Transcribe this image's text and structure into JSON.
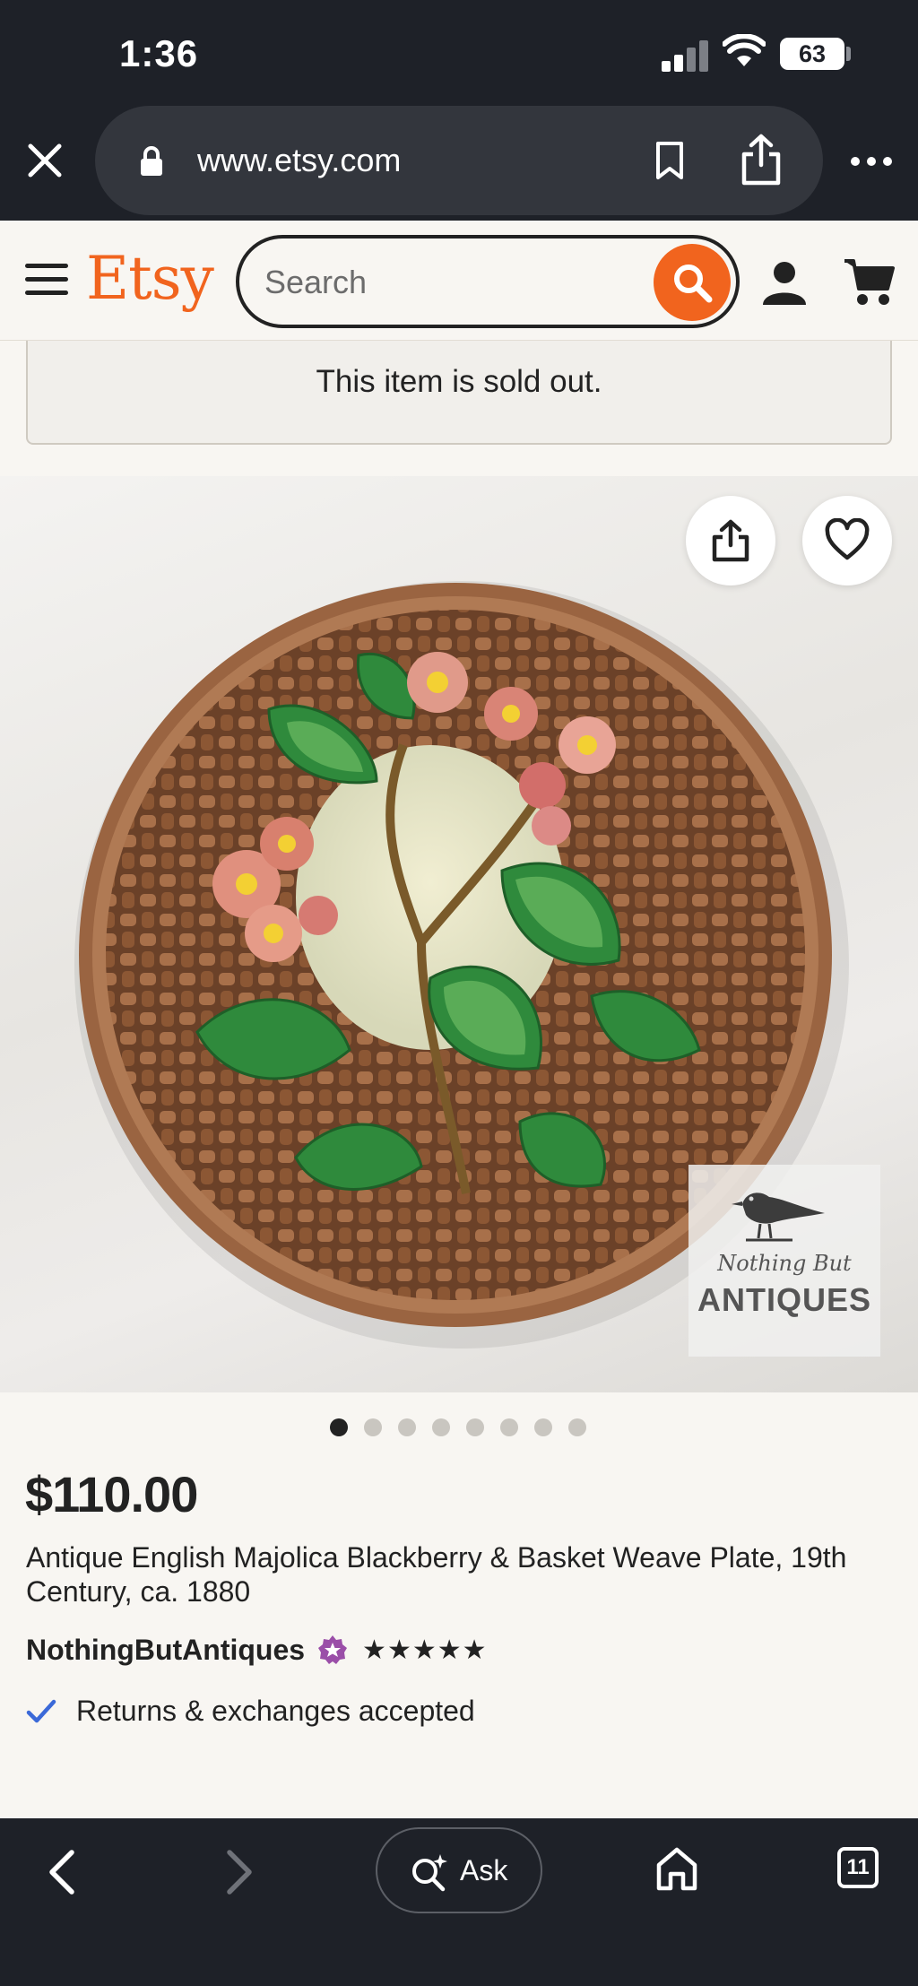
{
  "status_bar": {
    "time": "1:36",
    "battery": "63"
  },
  "browser": {
    "url": "www.etsy.com",
    "ask_label": "Ask",
    "tab_count": "11"
  },
  "header": {
    "logo": "Etsy",
    "search_placeholder": "Search",
    "brand_color": "#f1641e"
  },
  "listing": {
    "sold_out_message": "This item is sold out.",
    "price": "$110.00",
    "title": "Antique English Majolica Blackberry & Basket Weave Plate, 19th Century, ca. 1880",
    "shop_name": "NothingButAntiques",
    "rating_stars": "★★★★★",
    "returns_text": "Returns & exchanges accepted",
    "image_count": 8,
    "active_image_index": 0,
    "watermark": {
      "script": "Nothing But",
      "main": "ANTIQUES"
    }
  },
  "icons": {
    "close": "close-icon",
    "lock": "lock-icon",
    "bookmark": "bookmark-icon",
    "share": "share-icon",
    "more": "more-icon",
    "menu": "menu-icon",
    "search": "search-icon",
    "account": "user-icon",
    "cart": "cart-icon",
    "favorite": "heart-icon",
    "star_seller": "star-seller-badge-icon",
    "check": "check-icon",
    "back": "back-icon",
    "forward": "forward-icon",
    "home": "home-icon",
    "tabs": "tabs-icon"
  }
}
